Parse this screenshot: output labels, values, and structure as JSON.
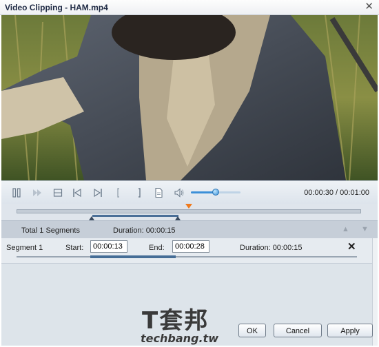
{
  "window": {
    "title": "Video Clipping - HAM.mp4",
    "close_glyph": "✕"
  },
  "player": {
    "time_display": "00:00:30 / 00:01:00",
    "volume_fraction": 0.5,
    "timeline_playhead_fraction": 0.5,
    "selection_start_fraction": 0.217,
    "selection_end_fraction": 0.467,
    "controls": [
      "pause-icon",
      "fast-forward-icon",
      "stop-icon",
      "previous-frame-icon",
      "next-frame-icon",
      "set-start-icon",
      "set-end-icon",
      "snapshot-icon",
      "volume-icon"
    ]
  },
  "segments": {
    "summary": "Total 1 Segments",
    "total_duration": "Duration: 00:00:15",
    "rows": [
      {
        "name": "Segment 1",
        "start_label": "Start:",
        "start_value": "00:00:13",
        "end_label": "End:",
        "end_value": "00:00:28",
        "duration": "Duration: 00:00:15",
        "delete_glyph": "✕"
      }
    ]
  },
  "buttons": {
    "ok": "OK",
    "cancel": "Cancel",
    "apply": "Apply"
  },
  "watermark": {
    "line1": "T套邦",
    "line2": "techbang.tw"
  }
}
